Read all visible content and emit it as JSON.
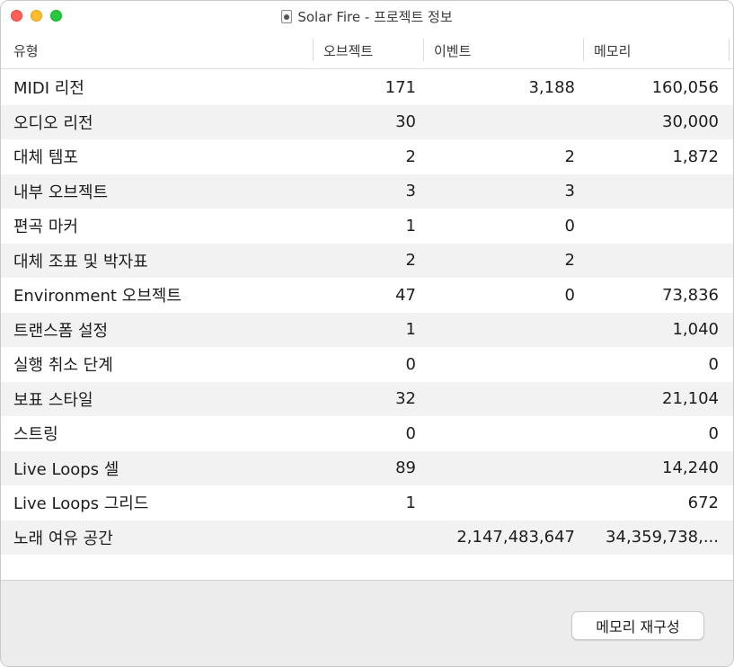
{
  "window": {
    "title": "Solar Fire - 프로젝트 정보",
    "doc_icon": "document-icon"
  },
  "table": {
    "headers": [
      "유형",
      "오브젝트",
      "이벤트",
      "메모리"
    ],
    "rows": [
      {
        "type": "MIDI 리전",
        "objects": "171",
        "events": "3,188",
        "memory": "160,056"
      },
      {
        "type": "오디오 리전",
        "objects": "30",
        "events": "",
        "memory": "30,000"
      },
      {
        "type": "대체 템포",
        "objects": "2",
        "events": "2",
        "memory": "1,872"
      },
      {
        "type": "내부 오브젝트",
        "objects": "3",
        "events": "3",
        "memory": ""
      },
      {
        "type": "편곡 마커",
        "objects": "1",
        "events": "0",
        "memory": ""
      },
      {
        "type": "대체 조표 및 박자표",
        "objects": "2",
        "events": "2",
        "memory": ""
      },
      {
        "type": "Environment 오브젝트",
        "objects": "47",
        "events": "0",
        "memory": "73,836"
      },
      {
        "type": "트랜스폼 설정",
        "objects": "1",
        "events": "",
        "memory": "1,040"
      },
      {
        "type": "실행 취소 단계",
        "objects": "0",
        "events": "",
        "memory": "0"
      },
      {
        "type": "보표 스타일",
        "objects": "32",
        "events": "",
        "memory": "21,104"
      },
      {
        "type": "스트링",
        "objects": "0",
        "events": "",
        "memory": "0"
      },
      {
        "type": "Live Loops 셀",
        "objects": "89",
        "events": "",
        "memory": "14,240"
      },
      {
        "type": "Live Loops 그리드",
        "objects": "1",
        "events": "",
        "memory": "672"
      },
      {
        "type": "노래 여유 공간",
        "objects": "",
        "events": "2,147,483,647",
        "memory": "34,359,738,..."
      }
    ]
  },
  "footer": {
    "rebuild_button": "메모리 재구성"
  },
  "colors": {
    "close": "#fe5f57",
    "minimize": "#febc2e",
    "maximize": "#28c840",
    "row_alt": "#f2f2f2",
    "footer_bg": "#ececec"
  }
}
